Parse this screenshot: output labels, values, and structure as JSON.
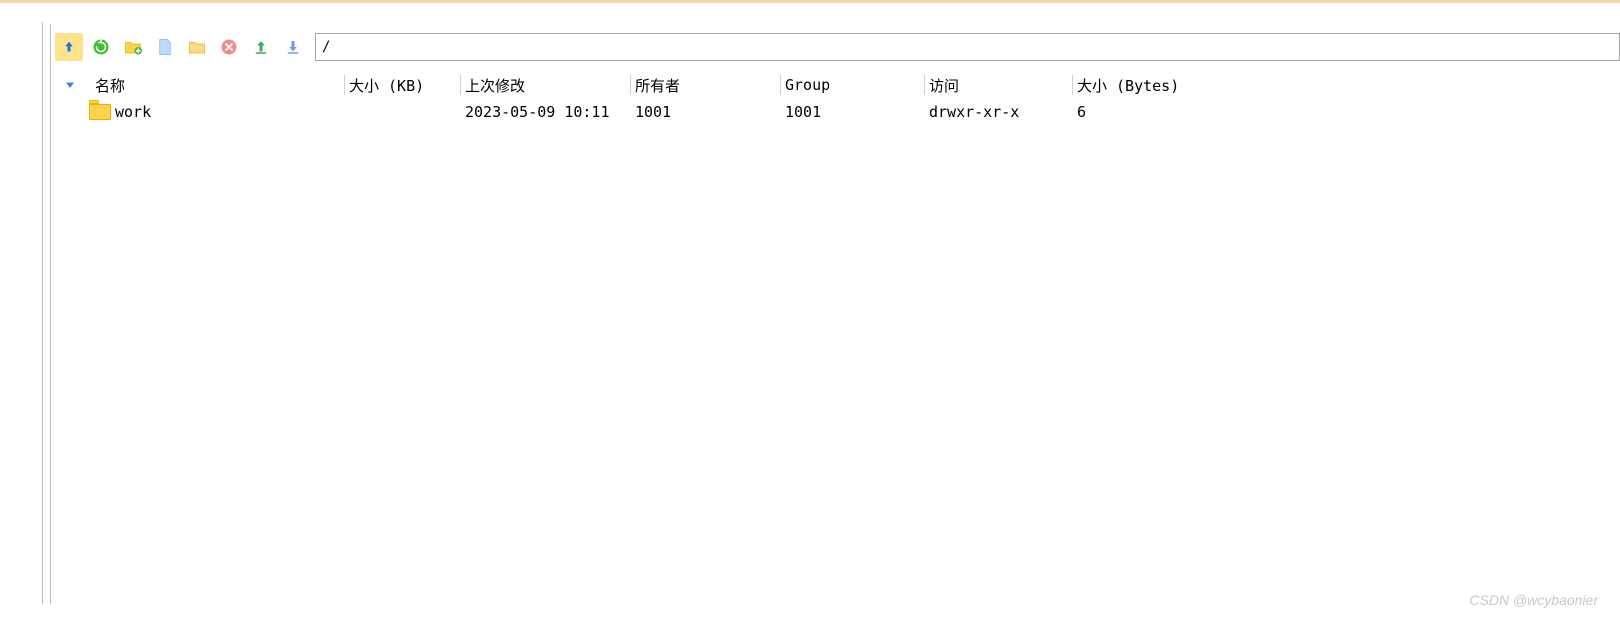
{
  "path": "/",
  "toolbar": {
    "up": "go-up",
    "refresh": "refresh",
    "newdir": "new-folder",
    "newfile": "new-file",
    "open": "open-folder",
    "delete": "delete",
    "upload": "upload",
    "download": "download"
  },
  "columns": {
    "name": "名称",
    "sizek": "大小 (KB)",
    "mod": "上次修改",
    "owner": "所有者",
    "group": "Group",
    "acc": "访问",
    "sizeb": "大小 (Bytes)"
  },
  "rows": [
    {
      "name": "work",
      "sizek": "",
      "mod": "2023-05-09 10:11",
      "owner": "1001",
      "group": "1001",
      "acc": "drwxr-xr-x",
      "sizeb": "6"
    }
  ],
  "watermark": "CSDN @wcybaonier"
}
